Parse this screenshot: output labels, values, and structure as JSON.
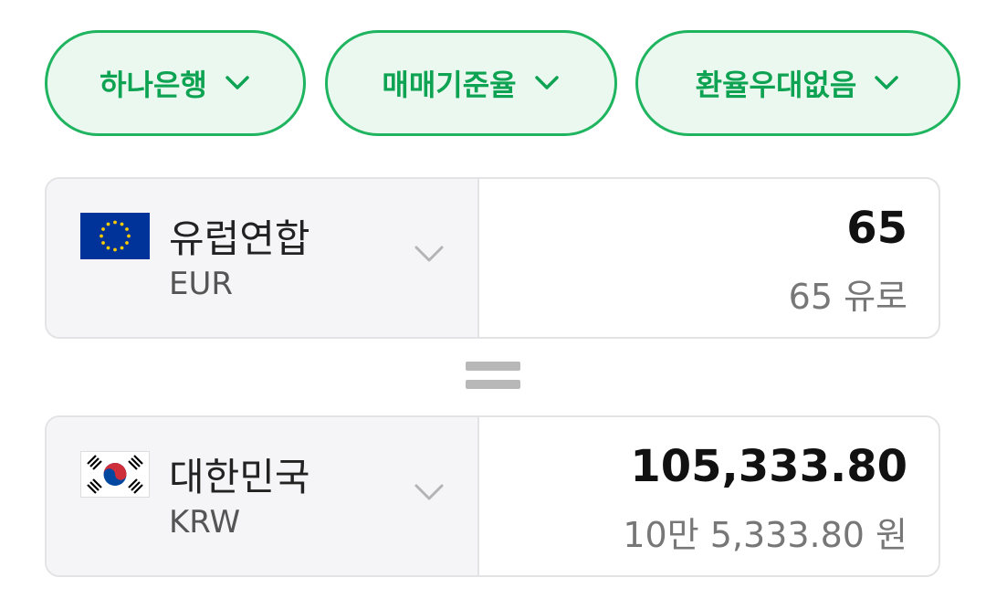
{
  "filters": {
    "bank": {
      "label": "하나은행",
      "icon": "chevron-down-icon"
    },
    "rate_type": {
      "label": "매매기준율",
      "icon": "chevron-down-icon"
    },
    "preferential": {
      "label": "환율우대없음",
      "icon": "chevron-down-icon"
    }
  },
  "converter": {
    "from": {
      "country": "유럽연합",
      "code": "EUR",
      "flag_icon": "eu-flag-icon",
      "amount": "65",
      "amount_words": "65 유로"
    },
    "equals_icon": "equals-icon",
    "to": {
      "country": "대한민국",
      "code": "KRW",
      "flag_icon": "korea-flag-icon",
      "amount": "105,333.80",
      "amount_words": "10만 5,333.80 원"
    }
  },
  "colors": {
    "accent": "#0ea352",
    "chip_border": "#1fb45f",
    "chip_bg": "#ebf8ef",
    "selector_bg": "#f5f5f7",
    "eu_blue": "#003399",
    "eu_star": "#ffcc00",
    "kr_red": "#cd2e3a",
    "kr_blue": "#0047a0"
  }
}
